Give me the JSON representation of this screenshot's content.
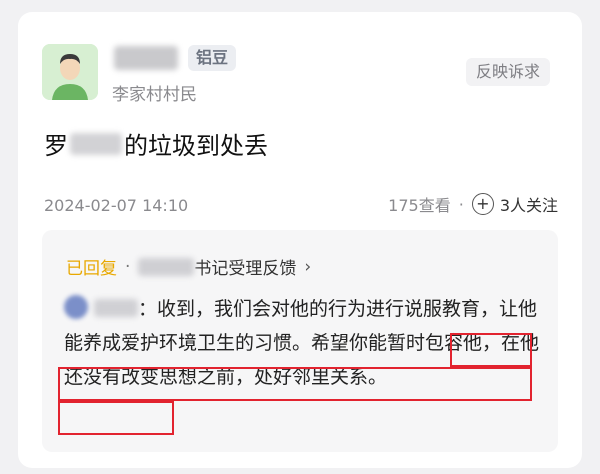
{
  "post": {
    "badge": "铝豆",
    "role": "李家村村民",
    "report": "反映诉求",
    "title_prefix": "罗",
    "title_suffix": "的垃圾到处丢",
    "date": "2024-02-07 14:10",
    "views": "175查看",
    "dot": "·",
    "follow": "3人关注"
  },
  "reply": {
    "status": "已回复",
    "sep": "·",
    "role": "书记受理反馈",
    "chevron": "›",
    "colon": "：",
    "text": "收到，我们会对他的行为进行说服教育，让他能养成爱护环境卫生的习惯。希望你能暂时包容他，在他还没有改变思想之前，处好邻里关系。"
  },
  "colors": {
    "accent": "#e8a800",
    "highlight": "#e2232f",
    "badge_bg": "#eceef2"
  },
  "icons": [
    "user-avatar-icon",
    "plus-circle-icon",
    "chevron-right-icon"
  ]
}
